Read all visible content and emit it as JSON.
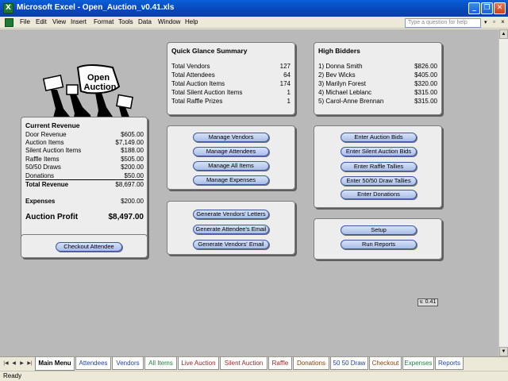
{
  "window": {
    "title": "Microsoft Excel - Open_Auction_v0.41.xls",
    "app_icon": "excel-icon"
  },
  "menu": {
    "items": [
      "File",
      "Edit",
      "View",
      "Insert",
      "Format",
      "Tools",
      "Data",
      "Window",
      "Help"
    ],
    "help_placeholder": "Type a question for help"
  },
  "logo": {
    "line1": "Open",
    "line2": "Auction"
  },
  "current_revenue": {
    "title": "Current Revenue",
    "rows": [
      {
        "label": "Door Revenue",
        "value": "$605.00"
      },
      {
        "label": "Auction Items",
        "value": "$7,149.00"
      },
      {
        "label": "Silent Auction Items",
        "value": "$188.00"
      },
      {
        "label": "Raffle Items",
        "value": "$505.00"
      },
      {
        "label": "50/50 Draws",
        "value": "$200.00"
      },
      {
        "label": "Donations",
        "value": "$50.00"
      }
    ],
    "total_label": "Total Revenue",
    "total_value": "$8,697.00",
    "expenses_label": "Expenses",
    "expenses_value": "$200.00",
    "profit_label": "Auction Profit",
    "profit_value": "$8,497.00"
  },
  "checkout_button": "Checkout Attendee",
  "summary": {
    "title": "Quick Glance Summary",
    "rows": [
      {
        "label": "Total Vendors",
        "value": "127"
      },
      {
        "label": "Total Attendees",
        "value": "64"
      },
      {
        "label": "Total Auction Items",
        "value": "174"
      },
      {
        "label": "Total Silent Auction Items",
        "value": "1"
      },
      {
        "label": "Total Raffle Prizes",
        "value": "1"
      }
    ]
  },
  "bidders": {
    "title": "High Bidders",
    "rows": [
      {
        "label": "1) Donna Smith",
        "value": "$826.00"
      },
      {
        "label": "2) Bev Wicks",
        "value": "$405.00"
      },
      {
        "label": "3) Marilyn Forest",
        "value": "$320.00"
      },
      {
        "label": "4) Michael Leblanc",
        "value": "$315.00"
      },
      {
        "label": "5) Carol-Anne Brennan",
        "value": "$315.00"
      }
    ]
  },
  "manage_buttons": [
    "Manage Vendors",
    "Manage Attendees",
    "Manage All Items",
    "Manage Expenses"
  ],
  "generate_buttons": [
    "Generate Vendors' Letters",
    "Generate Attendee's Email",
    "Generate Vendors' Email"
  ],
  "enter_buttons": [
    "Enter Auction Bids",
    "Enter Silent Auction Bids",
    "Enter Raffle Tallies",
    "Enter 50/50 Draw Tallies",
    "Enter Donations"
  ],
  "setup_buttons": [
    "Setup",
    "Run Reports"
  ],
  "version": "v. 0.41",
  "tabs": [
    {
      "label": "Main Menu",
      "color": "#000000",
      "active": true
    },
    {
      "label": "Attendees",
      "color": "#1f3f9f"
    },
    {
      "label": "Vendors",
      "color": "#1f3f9f"
    },
    {
      "label": "All Items",
      "color": "#1f7f3f"
    },
    {
      "label": "Live Auction",
      "color": "#9f1f1f"
    },
    {
      "label": "Silent Auction",
      "color": "#9f1f1f"
    },
    {
      "label": "Raffle",
      "color": "#9f1f1f"
    },
    {
      "label": "Donations",
      "color": "#7f3f00"
    },
    {
      "label": "50 50 Draw",
      "color": "#1f3f9f"
    },
    {
      "label": "Checkout",
      "color": "#7f3f00"
    },
    {
      "label": "Expenses",
      "color": "#1f7f3f"
    },
    {
      "label": "Reports",
      "color": "#1f3f9f"
    }
  ],
  "status": "Ready"
}
